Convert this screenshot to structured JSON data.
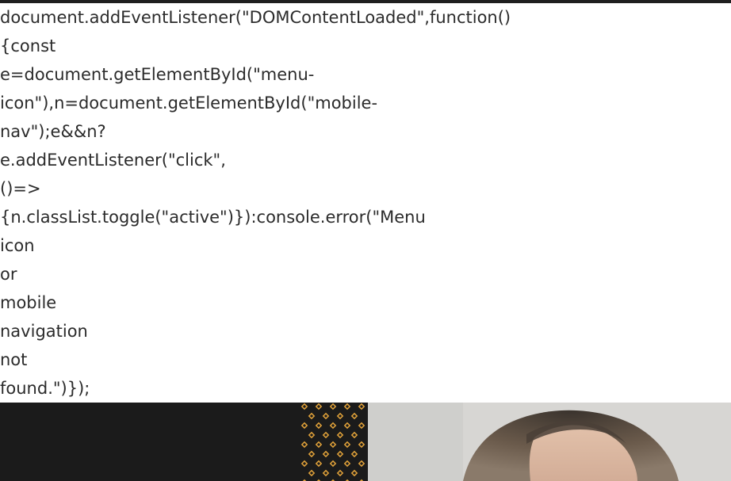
{
  "code_text": {
    "lines": [
      "document.addEventListener(\"DOMContentLoaded\",function()",
      "{const",
      "e=document.getElementById(\"menu-",
      "icon\"),n=document.getElementById(\"mobile-",
      "nav\");e&&n?",
      "e.addEventListener(\"click\",",
      "()=>",
      "{n.classList.toggle(\"active\")}):console.error(\"Menu",
      "icon",
      "or",
      "mobile",
      "navigation",
      "not",
      "found.\")});"
    ]
  },
  "hero": {
    "background_color": "#1b1b1b",
    "pattern_color": "#e1a23a",
    "photo_bg_color": "#d7d6d3",
    "photo_icon": "portrait-photo"
  }
}
